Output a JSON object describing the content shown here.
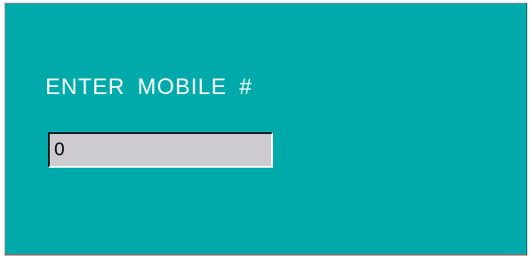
{
  "prompt": {
    "label": "ENTER MOBILE #"
  },
  "mobile_input": {
    "value": "0"
  },
  "colors": {
    "panel_background": "#00aaaa",
    "label_text": "#ffffff",
    "input_background": "#cdcbcf"
  }
}
